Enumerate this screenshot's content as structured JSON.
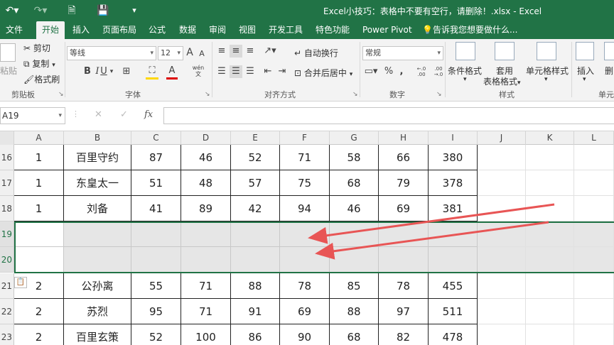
{
  "title": "Excel小技巧：表格中不要有空行，请删除！.xlsx - Excel",
  "tabs": [
    "文件",
    "开始",
    "插入",
    "页面布局",
    "公式",
    "数据",
    "审阅",
    "视图",
    "开发工具",
    "特色功能",
    "Power Pivot"
  ],
  "active_tab": "开始",
  "tell_me": "告诉我您想要做什么...",
  "ribbon": {
    "clipboard": {
      "paste": "粘贴",
      "cut": "剪切",
      "copy": "复制",
      "format_painter": "格式刷",
      "label": "剪贴板"
    },
    "font": {
      "name": "等线",
      "size": "12",
      "grow": "A",
      "shrink": "A",
      "bold": "B",
      "italic": "I",
      "underline": "U",
      "wen_top": "wén",
      "wen_bottom": "文",
      "label": "字体"
    },
    "alignment": {
      "wrap": "自动换行",
      "merge": "合并后居中",
      "label": "对齐方式"
    },
    "number": {
      "format": "常规",
      "percent": "%",
      "comma": ",",
      "inc_decimal": ".00→.0",
      "dec_decimal": ".00→.0",
      "label": "数字"
    },
    "styles": {
      "conditional": "条件格式",
      "table_line1": "套用",
      "table_line2": "表格格式",
      "cell_styles": "单元格样式",
      "label": "样式"
    },
    "cells": {
      "insert": "插入",
      "delete": "删",
      "label": "单元"
    }
  },
  "name_box": "A19",
  "formula_bar": {
    "cancel": "✕",
    "enter": "✓",
    "fx": "fx",
    "value": ""
  },
  "columns": [
    "A",
    "B",
    "C",
    "D",
    "E",
    "F",
    "G",
    "H",
    "I",
    "J",
    "K",
    "L"
  ],
  "rows": [
    {
      "num": "16",
      "cells": [
        "1",
        "百里守约",
        "87",
        "46",
        "52",
        "71",
        "58",
        "66",
        "380"
      ]
    },
    {
      "num": "17",
      "cells": [
        "1",
        "东皇太一",
        "51",
        "48",
        "57",
        "75",
        "68",
        "79",
        "378"
      ]
    },
    {
      "num": "18",
      "cells": [
        "1",
        "刘备",
        "41",
        "89",
        "42",
        "94",
        "46",
        "69",
        "381"
      ]
    },
    {
      "num": "19",
      "cells": [
        "",
        "",
        "",
        "",
        "",
        "",
        "",
        "",
        ""
      ]
    },
    {
      "num": "20",
      "cells": [
        "",
        "",
        "",
        "",
        "",
        "",
        "",
        "",
        ""
      ]
    },
    {
      "num": "21",
      "cells": [
        "2",
        "公孙离",
        "55",
        "71",
        "88",
        "78",
        "85",
        "78",
        "455"
      ]
    },
    {
      "num": "22",
      "cells": [
        "2",
        "苏烈",
        "95",
        "71",
        "91",
        "69",
        "88",
        "97",
        "511"
      ]
    },
    {
      "num": "23",
      "cells": [
        "2",
        "百里玄策",
        "52",
        "100",
        "86",
        "90",
        "68",
        "82",
        "478"
      ]
    }
  ],
  "colors": {
    "accent": "#217346",
    "arrow": "#e85555",
    "blank_row": "#e6e6e6"
  }
}
